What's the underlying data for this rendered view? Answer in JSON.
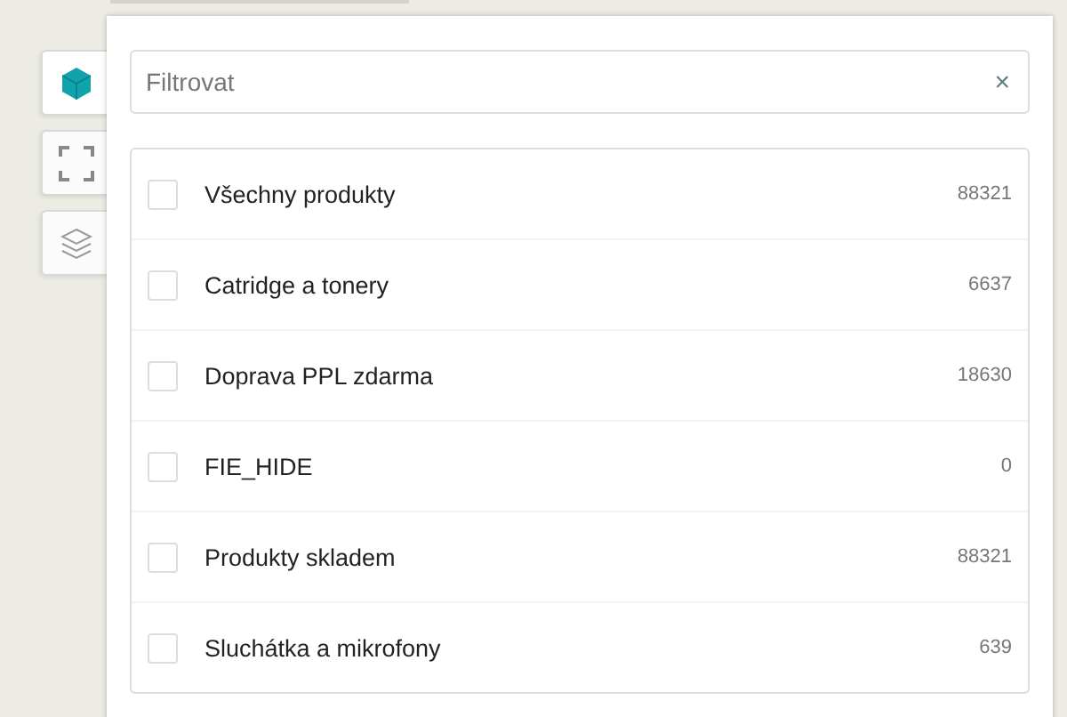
{
  "side_tabs": [
    {
      "kind": "cube",
      "selected": true
    },
    {
      "kind": "expand",
      "selected": false
    },
    {
      "kind": "layers",
      "selected": false
    }
  ],
  "filter": {
    "placeholder": "Filtrovat",
    "clear": "×"
  },
  "items": [
    {
      "label": "Všechny produkty",
      "count": "88321",
      "checked": false
    },
    {
      "label": "Catridge a tonery",
      "count": "6637",
      "checked": false
    },
    {
      "label": "Doprava PPL zdarma",
      "count": "18630",
      "checked": false
    },
    {
      "label": "FIE_HIDE",
      "count": "0",
      "checked": false
    },
    {
      "label": "Produkty skladem",
      "count": "88321",
      "checked": false
    },
    {
      "label": "Sluchátka a mikrofony",
      "count": "639",
      "checked": false
    }
  ]
}
